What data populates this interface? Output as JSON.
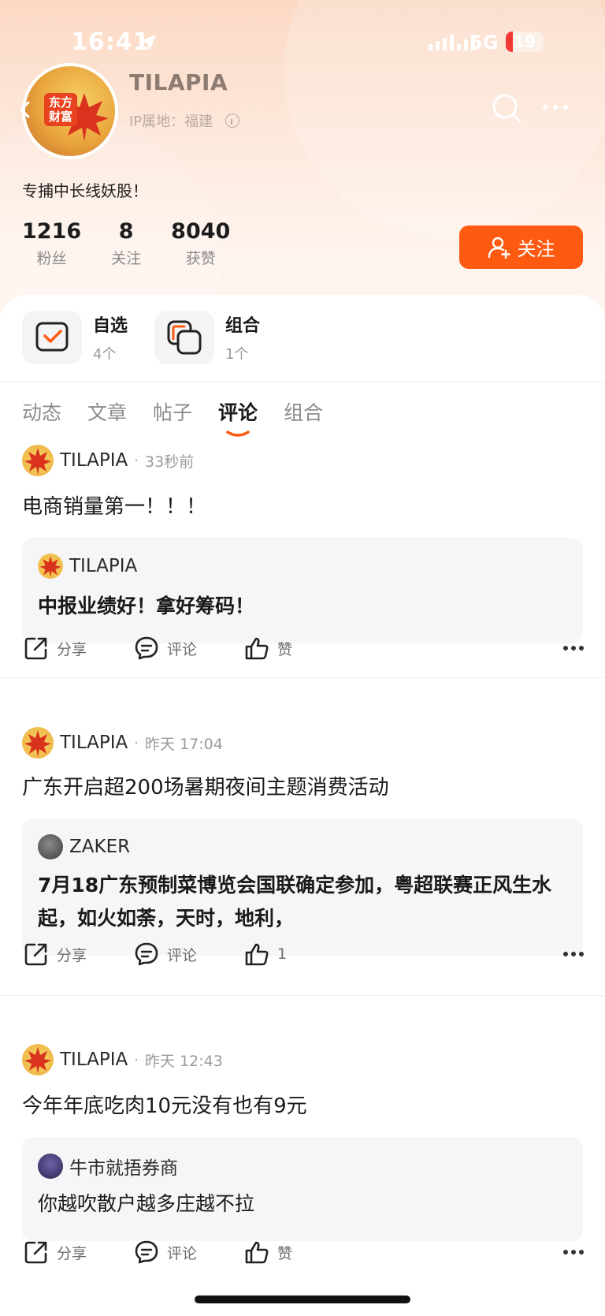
{
  "status_bar": {
    "time": "16:41",
    "network": "5G",
    "battery": "19",
    "battery_level": 0.19,
    "battery_color": "#f23a35"
  },
  "profile": {
    "brand_badge": "东方财富",
    "username": "TILAPIA",
    "ip_location": "IP属地：福建",
    "bio": "专捕中长线妖股！",
    "stats": [
      {
        "value": "1216",
        "label": "粉丝"
      },
      {
        "value": "8",
        "label": "关注"
      },
      {
        "value": "8040",
        "label": "获赞"
      }
    ],
    "follow_label": "关注"
  },
  "quick_access": [
    {
      "title": "自选",
      "sub": "4个",
      "icon": "watchlist-check-icon"
    },
    {
      "title": "组合",
      "sub": "1个",
      "icon": "portfolio-icon"
    }
  ],
  "tabs": [
    {
      "label": "动态",
      "active": false
    },
    {
      "label": "文章",
      "active": false
    },
    {
      "label": "帖子",
      "active": false
    },
    {
      "label": "评论",
      "active": true
    },
    {
      "label": "组合",
      "active": false
    }
  ],
  "posts": [
    {
      "author": "TILAPIA",
      "time": "33秒前",
      "text": "电商销量第一！！！",
      "quote_author": "TILAPIA",
      "quote_text": "中报业绩好！拿好筹码！",
      "share": "分享",
      "comment": "评论",
      "like": "赞"
    },
    {
      "author": "TILAPIA",
      "time": "昨天 17:04",
      "text": "广东开启超200场暑期夜间主题消费活动",
      "quote_author": "ZAKER",
      "quote_text": "7月18广东预制菜博览会国联确定参加，粤超联赛正风生水起，如火如荼，天时，地利，",
      "share": "分享",
      "comment": "评论",
      "like": "1"
    },
    {
      "author": "TILAPIA",
      "time": "昨天 12:43",
      "text": "今年年底吃肉10元没有也有9元",
      "quote_author": "牛市就捂券商",
      "quote_text": "你越吹散户越多庄越不拉",
      "share": "分享",
      "comment": "评论",
      "like": "赞"
    }
  ],
  "colors": {
    "accent": "#ff5a11",
    "header_gradient_top": "#fbd9c4"
  }
}
